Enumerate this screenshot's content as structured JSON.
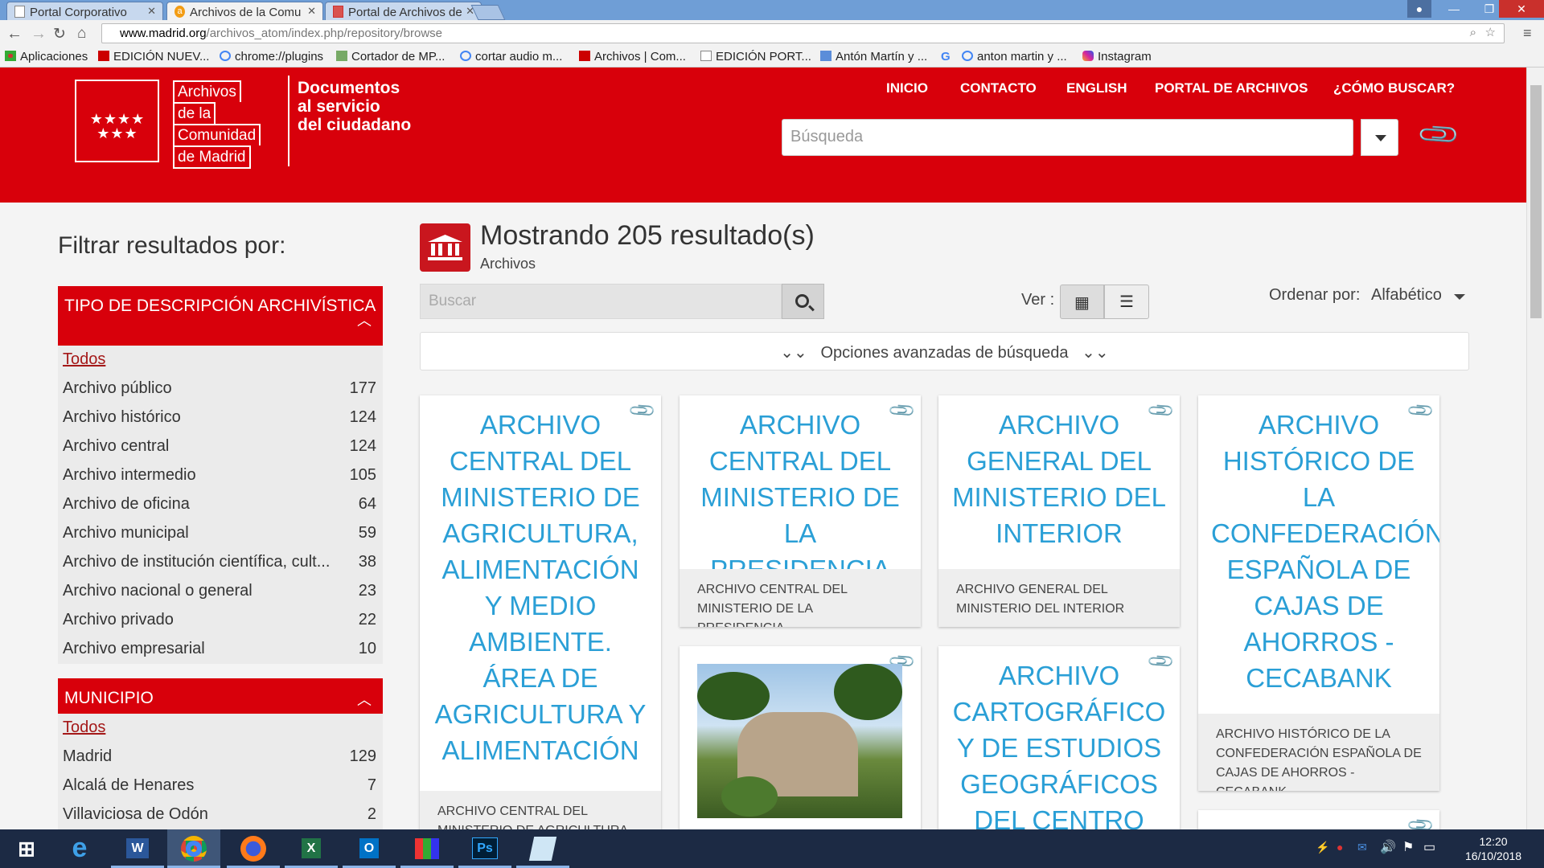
{
  "browser": {
    "tabs": [
      {
        "label": "Portal Corporativo",
        "icon": "page-icon"
      },
      {
        "label": "Archivos de la Comu",
        "icon": "archive-favicon"
      },
      {
        "label": "Portal de Archivos de",
        "icon": "portal-favicon"
      }
    ],
    "url_domain": "www.madrid.org",
    "url_path": "/archivos_atom/index.php/repository/browse",
    "bookmarks": [
      "Aplicaciones",
      "EDICIÓN NUEV...",
      "chrome://plugins",
      "Cortador de MP...",
      "cortar audio m...",
      "Archivos | Com...",
      "EDICIÓN PORT...",
      "Antón Martín y ...",
      "anton martin y ...",
      "Instagram"
    ]
  },
  "header": {
    "logo_lines": [
      "Archivos",
      "de la",
      "Comunidad",
      "de Madrid"
    ],
    "tagline": [
      "Documentos",
      "al servicio",
      "del ciudadano"
    ],
    "nav": [
      "INICIO",
      "CONTACTO",
      "ENGLISH",
      "PORTAL DE ARCHIVOS",
      "¿CÓMO BUSCAR?"
    ],
    "search_placeholder": "Búsqueda"
  },
  "sidebar": {
    "title": "Filtrar resultados por:",
    "facets": [
      {
        "heading": "TIPO DE DESCRIPCIÓN ARCHIVÍSTICA",
        "all_label": "Todos",
        "items": [
          {
            "label": "Archivo público",
            "count": "177"
          },
          {
            "label": "Archivo histórico",
            "count": "124"
          },
          {
            "label": "Archivo central",
            "count": "124"
          },
          {
            "label": "Archivo intermedio",
            "count": "105"
          },
          {
            "label": "Archivo de oficina",
            "count": "64"
          },
          {
            "label": "Archivo municipal",
            "count": "59"
          },
          {
            "label": "Archivo de institución científica, cult...",
            "count": "38"
          },
          {
            "label": "Archivo nacional o general",
            "count": "23"
          },
          {
            "label": "Archivo privado",
            "count": "22"
          },
          {
            "label": "Archivo empresarial",
            "count": "10"
          }
        ]
      },
      {
        "heading": "MUNICIPIO",
        "all_label": "Todos",
        "items": [
          {
            "label": "Madrid",
            "count": "129"
          },
          {
            "label": "Alcalá de Henares",
            "count": "7"
          },
          {
            "label": "Villaviciosa de Odón",
            "count": "2"
          }
        ]
      }
    ]
  },
  "main": {
    "results_title": "Mostrando 205 resultado(s)",
    "results_subtitle": "Archivos",
    "search_placeholder": "Buscar",
    "view_label": "Ver :",
    "sort_label": "Ordenar por:",
    "sort_value": "Alfabético",
    "advanced_label": "Opciones avanzadas de búsqueda",
    "cards": [
      {
        "title": "ARCHIVO CENTRAL DEL MINISTERIO DE AGRICULTURA, ALIMENTACIÓN Y MEDIO AMBIENTE. ÁREA DE AGRICULTURA Y ALIMENTACIÓN",
        "footer": "ARCHIVO CENTRAL DEL MINISTERIO DE AGRICULTURA,"
      },
      {
        "title": "ARCHIVO CENTRAL DEL MINISTERIO DE LA PRESIDENCIA",
        "footer": "ARCHIVO CENTRAL DEL MINISTERIO DE LA PRESIDENCIA"
      },
      {
        "title": "ARCHIVO GENERAL DEL MINISTERIO DEL INTERIOR",
        "footer": "ARCHIVO GENERAL DEL MINISTERIO DEL INTERIOR"
      },
      {
        "title": "ARCHIVO HISTÓRICO DE LA CONFEDERACIÓN ESPAÑOLA DE CAJAS DE AHORROS - CECABANK",
        "footer": "ARCHIVO HISTÓRICO DE LA CONFEDERACIÓN ESPAÑOLA DE CAJAS DE AHORROS - CECABANK"
      },
      {
        "title": "ARCHIVO CARTOGRÁFICO Y DE ESTUDIOS GEOGRÁFICOS DEL CENTRO",
        "footer": ""
      }
    ]
  },
  "taskbar": {
    "apps": [
      "start",
      "internet-explorer",
      "word",
      "chrome",
      "firefox",
      "excel",
      "outlook",
      "app-blocks",
      "photoshop",
      "notepad"
    ],
    "time": "12:20",
    "date": "16/10/2018"
  },
  "colors": {
    "brand_red": "#d8000b",
    "link_blue": "#2a9fd6",
    "taskbar": "#1c2a44"
  }
}
